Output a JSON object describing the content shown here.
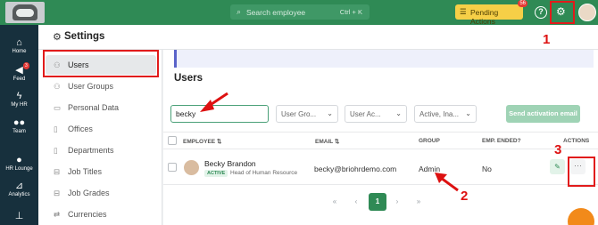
{
  "topbar": {
    "search_placeholder": "Search employee",
    "search_shortcut": "Ctrl + K",
    "pending_label": "Pending Actions",
    "pending_count": "56",
    "help_glyph": "?",
    "accent_color": "#2f8a55"
  },
  "leftnav": {
    "items": [
      {
        "label": "Home",
        "icon": "home-icon"
      },
      {
        "label": "Feed",
        "icon": "megaphone-icon",
        "badge": "3"
      },
      {
        "label": "My HR",
        "icon": "bolt-icon"
      },
      {
        "label": "Team",
        "icon": "team-icon"
      },
      {
        "label": "HR Lounge",
        "icon": "person-icon"
      },
      {
        "label": "Analytics",
        "icon": "chart-icon"
      },
      {
        "label": "",
        "icon": "org-chart-icon"
      }
    ]
  },
  "page": {
    "title": "Settings"
  },
  "settings_menu": {
    "items": [
      {
        "label": "Users",
        "icon": "users-icon",
        "active": true
      },
      {
        "label": "User Groups",
        "icon": "user-groups-icon"
      },
      {
        "label": "Personal Data",
        "icon": "id-card-icon"
      },
      {
        "label": "Offices",
        "icon": "building-icon"
      },
      {
        "label": "Departments",
        "icon": "building-icon"
      },
      {
        "label": "Job Titles",
        "icon": "briefcase-icon"
      },
      {
        "label": "Job Grades",
        "icon": "briefcase-icon"
      },
      {
        "label": "Currencies",
        "icon": "exchange-icon"
      }
    ]
  },
  "users": {
    "title": "Users",
    "search_value": "becky",
    "filters": [
      {
        "label": "User Gro..."
      },
      {
        "label": "User Ac..."
      },
      {
        "label": "Active, Ina..."
      }
    ],
    "send_button": "Send activation email",
    "columns": {
      "employee": "EMPLOYEE",
      "email": "EMAIL",
      "group": "GROUP",
      "ended": "EMP. ENDED?",
      "actions": "ACTIONS"
    },
    "rows": [
      {
        "name": "Becky Brandon",
        "status": "ACTIVE",
        "role": "Head of Human Resource",
        "email": "becky@briohrdemo.com",
        "group": "Admin",
        "ended": "No"
      }
    ],
    "pagination": {
      "first": "«",
      "prev": "‹",
      "current": "1",
      "next": "›",
      "last": "»"
    }
  },
  "annotations": {
    "step1": "1",
    "step2": "2",
    "step3": "3",
    "color": "#e11b1b"
  }
}
